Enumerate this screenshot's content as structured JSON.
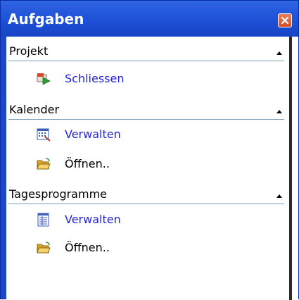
{
  "window": {
    "title": "Aufgaben",
    "close_icon": "close-icon"
  },
  "sections": [
    {
      "label": "Projekt",
      "collapse_icon": "chevron-up-icon",
      "items": [
        {
          "label": "Schliessen",
          "icon": "close-project-icon"
        }
      ]
    },
    {
      "label": "Kalender",
      "collapse_icon": "chevron-up-icon",
      "items": [
        {
          "label": "Verwalten",
          "icon": "calendar-manage-icon"
        },
        {
          "label": "Öffnen..",
          "icon": "open-folder-icon"
        }
      ]
    },
    {
      "label": "Tagesprogramme",
      "collapse_icon": "chevron-up-icon",
      "items": [
        {
          "label": "Verwalten",
          "icon": "schedule-manage-icon"
        },
        {
          "label": "Öffnen..",
          "icon": "open-folder-icon"
        }
      ]
    }
  ],
  "colors": {
    "titlebar": "#1c4fd6",
    "link": "#2222dd",
    "close_button": "#d34d2a"
  }
}
